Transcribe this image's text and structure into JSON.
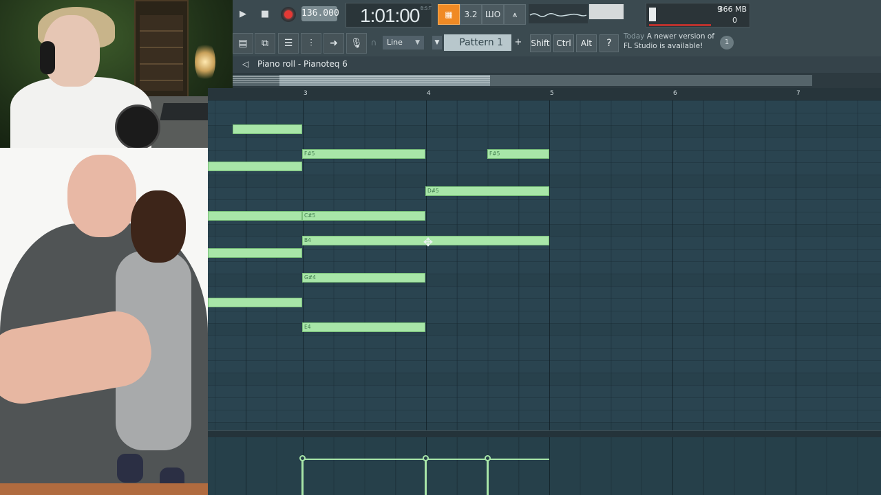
{
  "transport": {
    "tempo": "136.000",
    "time": "1:01:00",
    "time_mode": "B:S:T"
  },
  "toolbar": {
    "mode_buttons": [
      "3.2",
      "ШО"
    ],
    "cpu_poly": "9",
    "memory": "366 MB",
    "cpu_zero": "0",
    "snap": "Line",
    "pattern": "Pattern 1",
    "pattern_add": "+",
    "modifiers": [
      "Shift",
      "Ctrl",
      "Alt"
    ],
    "news_today": "Today",
    "news_text": "A newer version of FL Studio is available!",
    "news_count": "1"
  },
  "piano_roll": {
    "title": "Piano roll - Pianoteq 6",
    "bars": [
      "3",
      "4",
      "5",
      "6",
      "7"
    ],
    "notes": [
      {
        "label": "F#5"
      },
      {
        "label": "F#5"
      },
      {
        "label": "D#5"
      },
      {
        "label": "C#5"
      },
      {
        "label": "B4"
      },
      {
        "label": "G#4"
      },
      {
        "label": "E4"
      }
    ]
  },
  "colors": {
    "accent_orange": "#f08a24",
    "note_green": "#a8e6a8",
    "grid_bg": "#2a4450"
  },
  "icons": [
    "play-icon",
    "stop-icon",
    "record-icon",
    "speaker-icon",
    "move-cursor-icon",
    "hint-icon"
  ]
}
